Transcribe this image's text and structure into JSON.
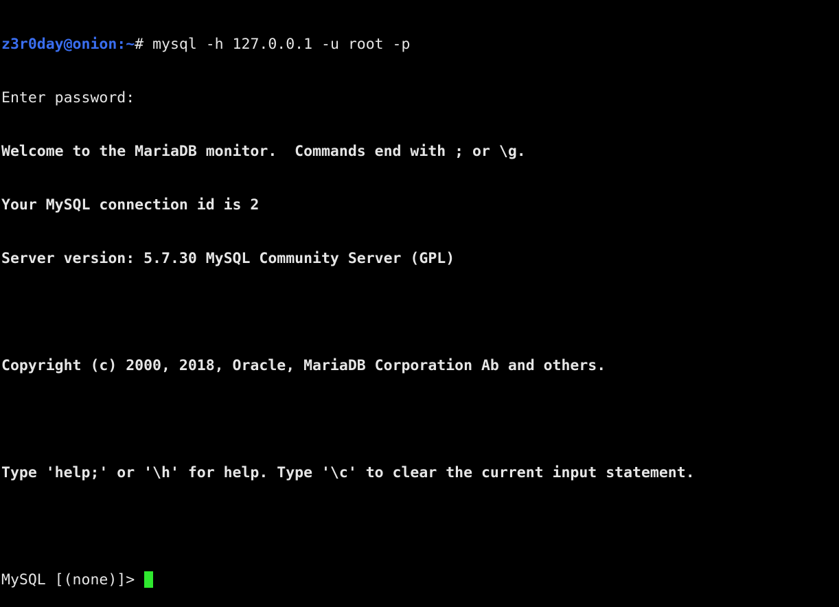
{
  "shell": {
    "user_host": "z3r0day@onion",
    "cwd": ":~",
    "prompt_symbol": "# ",
    "command": "mysql -h 127.0.0.1 -u root -p"
  },
  "output": {
    "enter_password": "Enter password:",
    "welcome": "Welcome to the MariaDB monitor.  Commands end with ; or \\g.",
    "connection_id": "Your MySQL connection id is 2",
    "server_version": "Server version: 5.7.30 MySQL Community Server (GPL)",
    "copyright": "Copyright (c) 2000, 2018, Oracle, MariaDB Corporation Ab and others.",
    "help_hint": "Type 'help;' or '\\h' for help. Type '\\c' to clear the current input statement."
  },
  "mysql_prompt": {
    "text": "MySQL [(none)]> "
  },
  "colors": {
    "background": "#000000",
    "text": "#e6e6e6",
    "prompt_user": "#3a6ef0",
    "cursor": "#2fe82f"
  }
}
